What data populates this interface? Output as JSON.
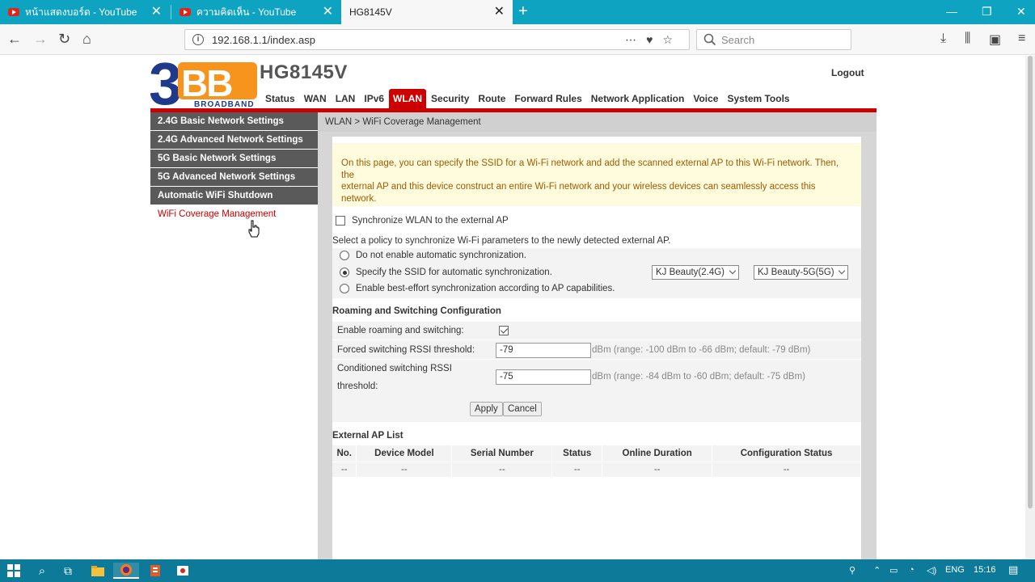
{
  "browser": {
    "tabs": [
      {
        "title": "หน้าแสดงบอร์ด - YouTube",
        "icon": "youtube-icon"
      },
      {
        "title": "ความคิดเห็น - YouTube",
        "icon": "youtube-icon"
      },
      {
        "title": "HG8145V",
        "icon": ""
      }
    ],
    "url": "192.168.1.1/index.asp",
    "search_placeholder": "Search"
  },
  "router": {
    "brand_big": "3BB",
    "brand_small": "BROADBAND",
    "model": "HG8145V",
    "logout": "Logout",
    "menu": [
      "Status",
      "WAN",
      "LAN",
      "IPv6",
      "WLAN",
      "Security",
      "Route",
      "Forward Rules",
      "Network Application",
      "Voice",
      "System Tools"
    ],
    "active_menu": "WLAN"
  },
  "sidebar": {
    "items": [
      "2.4G Basic Network Settings",
      "2.4G Advanced Network Settings",
      "5G Basic Network Settings",
      "5G Advanced Network Settings",
      "Automatic WiFi Shutdown",
      "WiFi Coverage Management"
    ]
  },
  "content": {
    "breadcrumb": "WLAN > WiFi Coverage Management",
    "notice_line1": "On this page, you can specify the SSID for a Wi-Fi network and add the scanned external AP to this Wi-Fi network. Then, the",
    "notice_line2": "external AP and this device construct an entire Wi-Fi network and your wireless devices can seamlessly access this",
    "notice_line3": "network.",
    "sync_label": "Synchronize WLAN to the external AP",
    "policy_title": "Select a policy to synchronize Wi-Fi parameters to the newly detected external AP.",
    "policy_options": [
      "Do not enable automatic synchronization.",
      "Specify the SSID for automatic synchronization.",
      "Enable best-effort synchronization according to AP capabilities."
    ],
    "ssid_24": "KJ Beauty(2.4G)",
    "ssid_5": "KJ Beauty-5G(5G)",
    "roaming_title": "Roaming and Switching Configuration",
    "roaming_label": "Enable roaming and switching:",
    "forced_label": "Forced switching RSSI threshold:",
    "forced_value": "-79",
    "forced_hint": "dBm (range: -100 dBm to -66 dBm; default: -79 dBm)",
    "cond_label_1": "Conditioned switching RSSI",
    "cond_label_2": "threshold:",
    "cond_value": "-75",
    "cond_hint": "dBm (range: -84 dBm to -60 dBm; default: -75 dBm)",
    "apply": "Apply",
    "cancel": "Cancel",
    "ap_title": "External AP List",
    "ap_headers": [
      "No.",
      "Device Model",
      "Serial Number",
      "Status",
      "Online Duration",
      "Configuration Status"
    ],
    "ap_row": [
      "--",
      "--",
      "--",
      "--",
      "--",
      "--"
    ]
  },
  "taskbar": {
    "lang": "ENG",
    "time": "15:16"
  },
  "colors": {
    "accent_red": "#cc0000",
    "tab_strip": "#0fa3c2",
    "taskbar": "#0d7a99"
  }
}
